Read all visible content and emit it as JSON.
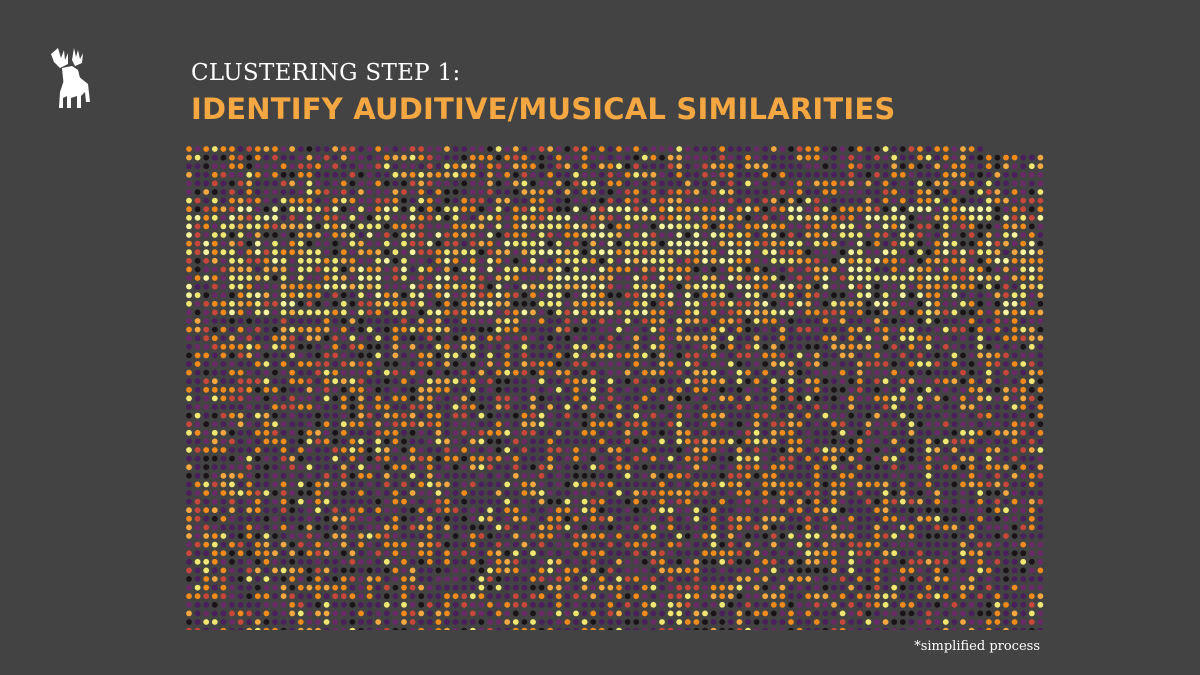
{
  "header": {
    "subtitle": "CLUSTERING STEP 1:",
    "title": "IDENTIFY AUDITIVE/MUSICAL SIMILARITIES"
  },
  "footnote": "*simplified process",
  "logo": {
    "icon": "moose-icon",
    "color": "#ffffff"
  },
  "colors": {
    "background": "#434343",
    "title_accent": "#f5a742",
    "palette": [
      "#4b1e5c",
      "#6a2a68",
      "#1a1418",
      "#f28a1c",
      "#f5a742",
      "#c8463a",
      "#f1e873",
      "#f7f5a0"
    ]
  }
}
